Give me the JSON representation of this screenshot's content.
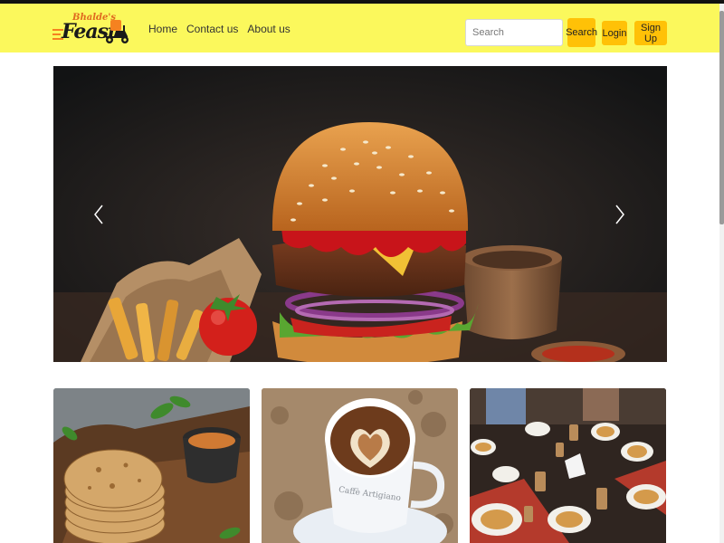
{
  "brand": {
    "tagline": "Bhalde's",
    "name": "Feast"
  },
  "nav": {
    "links": [
      "Home",
      "Contact us",
      "About us"
    ]
  },
  "search": {
    "placeholder": "Search",
    "button_label": "Search"
  },
  "auth": {
    "login_label": "Login",
    "signup_label": "Sign Up"
  },
  "carousel": {
    "prev_icon": "chevron-left-icon",
    "next_icon": "chevron-right-icon",
    "current_image": "burger with fries, tomato and wooden bowl"
  },
  "cards": [
    {
      "image": "stacked parathas with curry"
    },
    {
      "image": "latte art coffee cup on saucer",
      "cup_text": "Caffè Artigiano"
    },
    {
      "image": "dining table with many dishes"
    }
  ],
  "colors": {
    "navbar": "#fbf85c",
    "button": "#ffc107",
    "logo_orange": "#f58220"
  }
}
